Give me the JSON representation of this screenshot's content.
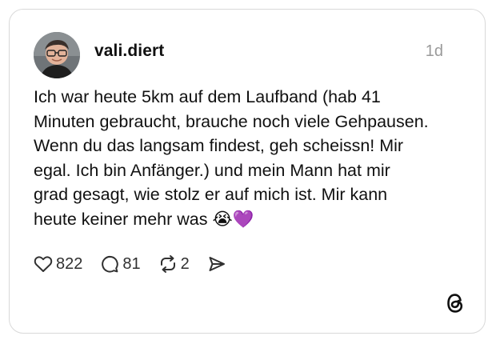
{
  "post": {
    "username": "vali.diert",
    "timestamp": "1d",
    "text": "Ich war heute 5km auf dem Laufband (hab 41\nMinuten gebraucht, brauche noch viele Gehpausen.\nWenn du das langsam findest, geh scheissn! Mir\negal. Ich bin Anfänger.) und mein Mann hat mir\ngrad gesagt, wie stolz er auf mich ist. Mir kann\nheute keiner mehr was 😭💜"
  },
  "actions": {
    "likes": "822",
    "replies": "81",
    "reposts": "2"
  },
  "icons": {
    "like": "heart-icon",
    "reply": "speech-bubble-icon",
    "repost": "repost-icon",
    "share": "send-icon",
    "brand": "threads-logo-icon"
  }
}
